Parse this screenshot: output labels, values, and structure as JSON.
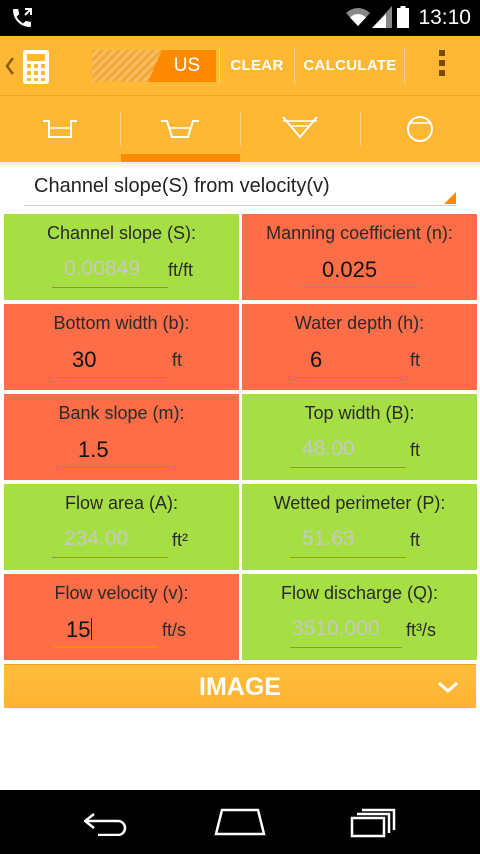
{
  "status_bar": {
    "time": "13:10"
  },
  "action_bar": {
    "unit_selected": "US",
    "clear_label": "CLEAR",
    "calculate_label": "CALCULATE"
  },
  "tabs": [
    {
      "icon": "rectangular-channel-icon"
    },
    {
      "icon": "trapezoidal-channel-icon",
      "selected": true
    },
    {
      "icon": "triangular-channel-icon"
    },
    {
      "icon": "circular-channel-icon"
    }
  ],
  "mode_spinner": {
    "value": "Channel slope(S) from velocity(v)"
  },
  "fields": [
    {
      "label": "Channel slope (S):",
      "value": "0.00849",
      "unit": "ft/ft",
      "state": "computed"
    },
    {
      "label": "Manning coefficient (n):",
      "value": "0.025",
      "unit": "",
      "state": "input"
    },
    {
      "label": "Bottom width (b):",
      "value": "30",
      "unit": "ft",
      "state": "input"
    },
    {
      "label": "Water depth (h):",
      "value": "6",
      "unit": "ft",
      "state": "input"
    },
    {
      "label": "Bank slope (m):",
      "value": "1.5",
      "unit": "",
      "state": "input"
    },
    {
      "label": "Top width (B):",
      "value": "48.00",
      "unit": "ft",
      "state": "computed"
    },
    {
      "label": "Flow area (A):",
      "value": "234.00",
      "unit": "ft²",
      "state": "computed"
    },
    {
      "label": "Wetted perimeter (P):",
      "value": "51.63",
      "unit": "ft",
      "state": "computed"
    },
    {
      "label": "Flow velocity (v):",
      "value": "15",
      "unit": "ft/s",
      "state": "input",
      "focused": true
    },
    {
      "label": "Flow discharge (Q):",
      "value": "3510.000",
      "unit": "ft³/s",
      "state": "computed"
    }
  ],
  "image_section": {
    "title": "IMAGE"
  },
  "colors": {
    "accent": "#ff8a00",
    "bar": "#ffb833",
    "input_cell": "#fd6d47",
    "output_cell": "#a6df43"
  }
}
